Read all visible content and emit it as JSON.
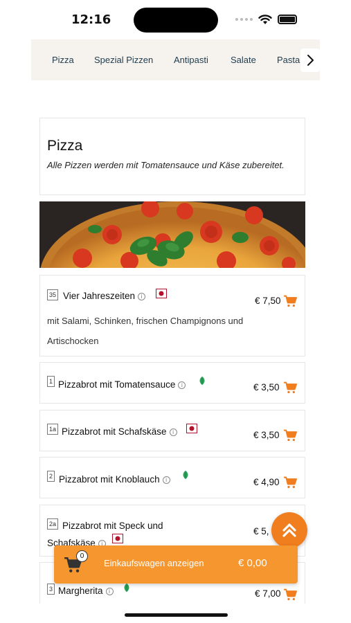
{
  "status_bar": {
    "time": "12:16"
  },
  "categories": [
    "Pizza",
    "Spezial Pizzen",
    "Antipasti",
    "Salate",
    "Pasta"
  ],
  "section": {
    "title": "Pizza",
    "description": "Alle Pizzen werden mit Tomatensauce und Käse zubereitet."
  },
  "products": [
    {
      "number": "35",
      "name": "Vier Jahreszeiten",
      "tag": "meat",
      "price": "€ 7,50",
      "description": "mit Salami, Schinken, frischen Champignons und Artischocken"
    },
    {
      "number": "1",
      "name": "Pizzabrot mit Tomatensauce",
      "tag": "vegetarian",
      "price": "€ 3,50"
    },
    {
      "number": "1a",
      "name": "Pizzabrot mit Schafskäse",
      "tag": "meat",
      "price": "€ 3,50"
    },
    {
      "number": "2",
      "name": "Pizzabrot mit Knoblauch",
      "tag": "vegetarian",
      "price": "€ 4,90"
    },
    {
      "number": "2a",
      "name_line1": "Pizzabrot mit Speck und",
      "name_line2": "Schafskäse",
      "tag": "meat",
      "price": "€ 5,"
    },
    {
      "number": "3",
      "name": "Margherita",
      "tag": "vegetarian",
      "price": "€ 7,00"
    }
  ],
  "cart": {
    "count": "0",
    "label": "Einkaufswagen anzeigen",
    "total": "€ 0,00"
  },
  "colors": {
    "accent": "#f6962f",
    "cart_icon": "#f07d1e",
    "meat_tag": "#b3122c",
    "veg_tag": "#2aa35a",
    "nav_bg": "#f6f3ee"
  },
  "icons": {
    "cart": "shopping-cart-icon",
    "info": "info-icon",
    "meat": "meat-tag-icon",
    "vegetarian": "leaf-icon",
    "next": "chevron-right-icon",
    "scroll_top": "double-chevron-up-icon"
  }
}
